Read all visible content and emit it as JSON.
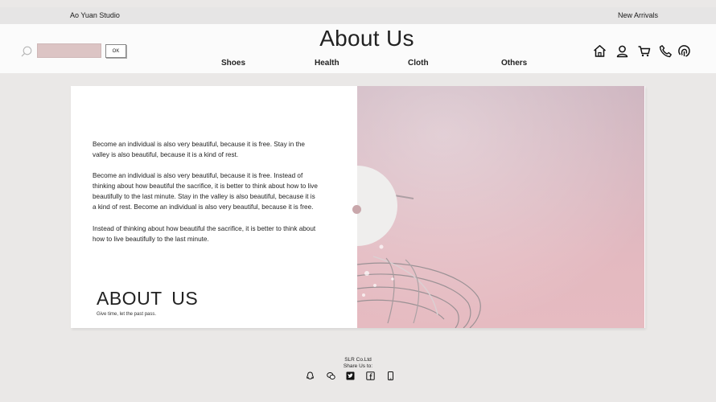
{
  "topbar": {
    "brand": "Ao Yuan Studio",
    "new_arrivals": "New Arrivals"
  },
  "header": {
    "title": "About Us",
    "search": {
      "placeholder": "",
      "button_label": "OK"
    },
    "nav": [
      "Shoes",
      "Health",
      "Cloth",
      "Others"
    ],
    "icons": [
      "home-icon",
      "user-icon",
      "cart-icon",
      "phone-icon",
      "support-icon"
    ]
  },
  "content": {
    "paragraphs": [
      "Become an individual is also very beautiful, because it is free. Stay in the valley is also beautiful, because it is a kind of rest.",
      "Become an individual is also very beautiful, because it is free. Instead of thinking about how beautiful the sacrifice, it is better to think about how to live beautifully to the last minute. Stay in the valley is also beautiful, because it is a kind of rest. Become an individual is also very beautiful, because it is free.",
      "Instead of thinking about how beautiful the sacrifice, it is better to think about how to live beautifully to the last minute."
    ],
    "big_title": "ABOUT US",
    "tagline": "Give time, let the past pass.",
    "photo_icon": "pink-sky-photo"
  },
  "footer": {
    "company": "SLR Co.Ltd",
    "share": "Share Us to:",
    "icons": [
      "qq-icon",
      "wechat-icon",
      "twitter-icon",
      "facebook-icon",
      "mobile-icon"
    ]
  },
  "colors": {
    "accent": "#dcc4c4",
    "background": "#eae8e7",
    "photo": "#e3b9c0"
  }
}
